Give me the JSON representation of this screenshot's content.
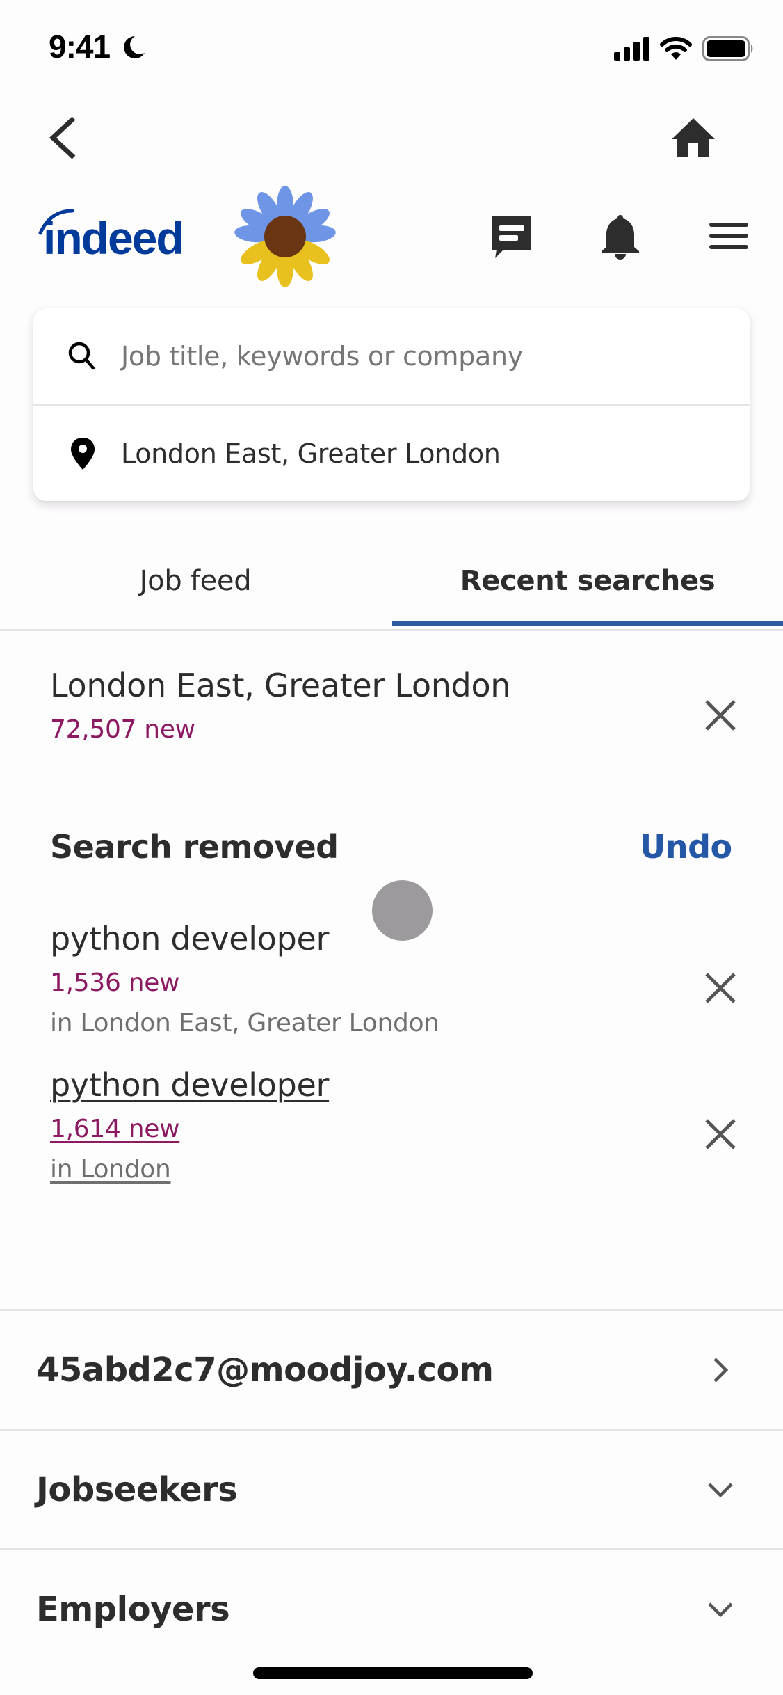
{
  "status_bar": {
    "time": "9:41",
    "icons": [
      "moon-icon",
      "cellular-signal-icon",
      "wifi-icon",
      "battery-icon"
    ]
  },
  "nav": {
    "back_icon": "chevron-left-icon",
    "home_icon": "home-icon"
  },
  "header": {
    "logo_text": "indeed",
    "brand_color": "#003a9b",
    "icons": [
      "sunflower-icon",
      "messages-icon",
      "notifications-bell-icon",
      "hamburger-menu-icon"
    ]
  },
  "search": {
    "what_placeholder": "Job title, keywords or company",
    "what_value": "",
    "where_value": "London East, Greater London"
  },
  "tabs": [
    {
      "label": "Job feed",
      "active": false
    },
    {
      "label": "Recent searches",
      "active": true
    }
  ],
  "accent_color": "#2d5aa0",
  "count_color": "#8c1a63",
  "recent_searches": [
    {
      "title": "London East, Greater London",
      "count": "72,507 new",
      "location": ""
    },
    {
      "title": "python developer",
      "count": "1,536 new",
      "location": "in London East, Greater London"
    },
    {
      "title": "python developer",
      "count": "1,614 new",
      "location": "in London"
    }
  ],
  "removed_notice": {
    "label": "Search removed",
    "undo_label": "Undo"
  },
  "footer": {
    "account_email": "45abd2c7@moodjoy.com",
    "sections": [
      "Jobseekers",
      "Employers"
    ]
  }
}
